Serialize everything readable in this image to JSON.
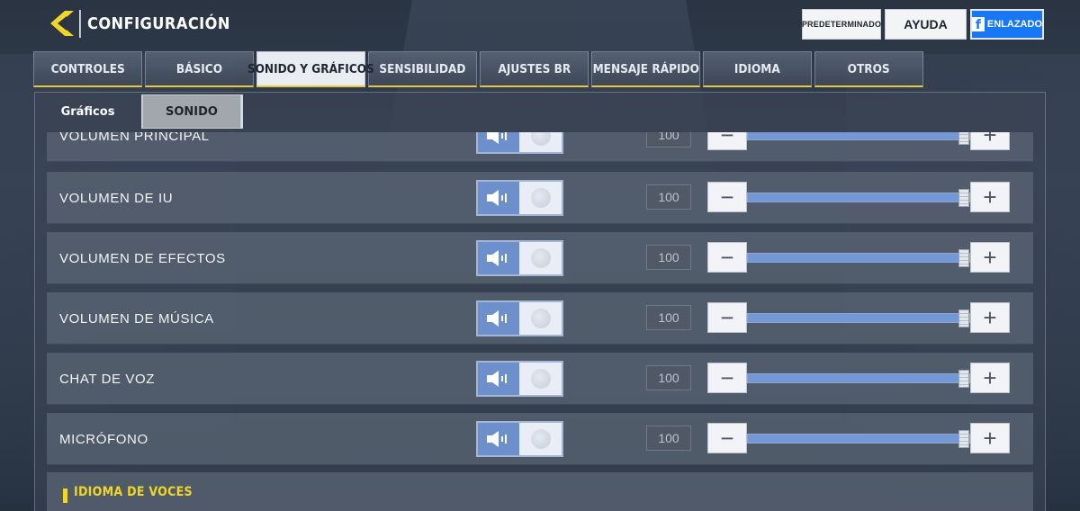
{
  "header": {
    "title": "CONFIGURACIÓN",
    "back_icon": "back-arrow-icon",
    "buttons": {
      "default_label": "PREDETERMINADO",
      "help_label": "AYUDA",
      "facebook_icon_char": "f",
      "facebook_label": "ENLAZADO"
    }
  },
  "tabs": [
    {
      "label": "CONTROLES"
    },
    {
      "label": "BÁSICO"
    },
    {
      "label": "SONIDO Y GRÁFICOS"
    },
    {
      "label": "SENSIBILIDAD"
    },
    {
      "label": "AJUSTES BR"
    },
    {
      "label": "MENSAJE RÁPIDO"
    },
    {
      "label": "IDIOMA"
    },
    {
      "label": "OTROS"
    }
  ],
  "active_tab": 2,
  "subtabs": [
    {
      "label": "Gráficos"
    },
    {
      "label": "SONIDO"
    }
  ],
  "active_subtab": 1,
  "settings": [
    {
      "label": "VOLUMEN PRINCIPAL",
      "value": "100",
      "level": 1.0,
      "enabled": true
    },
    {
      "label": "VOLUMEN DE IU",
      "value": "100",
      "level": 1.0,
      "enabled": true
    },
    {
      "label": "VOLUMEN DE EFECTOS",
      "value": "100",
      "level": 1.0,
      "enabled": true
    },
    {
      "label": "VOLUMEN DE MÚSICA",
      "value": "100",
      "level": 1.0,
      "enabled": true
    },
    {
      "label": "CHAT DE VOZ",
      "value": "100",
      "level": 1.0,
      "enabled": true
    },
    {
      "label": "MICRÓFONO",
      "value": "100",
      "level": 1.0,
      "enabled": true
    }
  ],
  "slider_buttons": {
    "minus": "−",
    "plus": "+"
  },
  "section": {
    "title": "IDIOMA DE VOCES"
  },
  "colors": {
    "accent_yellow": "#e5c93a",
    "toggle_blue": "#6d8fcb",
    "slider_fill": "#7497d6",
    "facebook_blue": "#1877f2"
  }
}
